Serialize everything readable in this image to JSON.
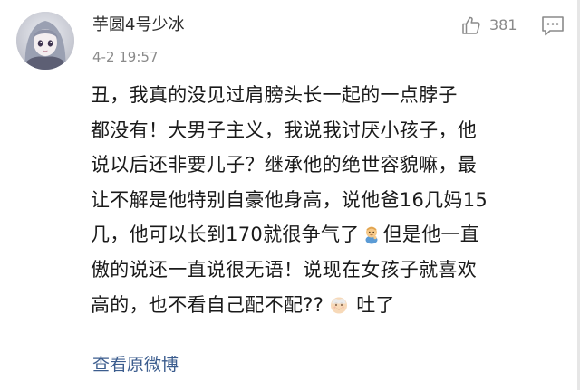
{
  "comment": {
    "author": "芋圆4号少冰",
    "timestamp": "4-2 19:57",
    "likes": "381",
    "icons": {
      "like": "thumbs-up-icon",
      "comment": "comment-bubble-icon"
    },
    "body_lines": [
      [
        "丑，我真的没见过肩膀头长一起的一点脖子"
      ],
      [
        "都没有！大男子主义，我说我讨厌小孩子，他"
      ],
      [
        "说以后还非要儿子？继承他的绝世容貌嘛，最"
      ],
      [
        "让不解是他特别自豪他身高，说他爸16几妈15"
      ],
      [
        "几，他可以长到170就很争气了",
        "但是他一直"
      ],
      [
        "傲的说还一直说很无语！说现在女孩子就喜欢"
      ],
      [
        "高的，也不看自己配不配??",
        "吐了"
      ]
    ],
    "emojis": [
      "baby-emoji",
      "grandpa-face-emoji"
    ],
    "link": "查看原微博"
  },
  "colors": {
    "text": "#1a1a1a",
    "meta": "#8a8a8a",
    "link": "#3c5d8e"
  }
}
